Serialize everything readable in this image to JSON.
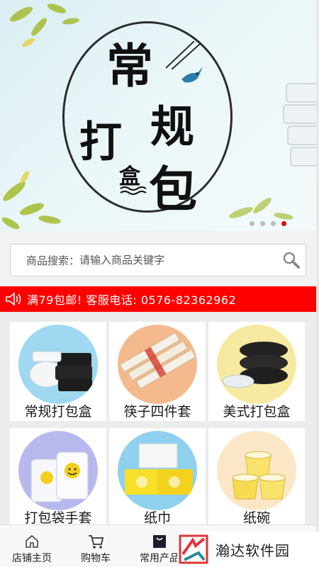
{
  "banner": {
    "title_chars": [
      "常",
      "规",
      "打",
      "包",
      "盒"
    ],
    "slides": 4,
    "active_slide": 4
  },
  "search": {
    "label": "商品搜索：",
    "placeholder": "请输入商品关键字"
  },
  "notice": {
    "text": "满79包邮! 客服电话: 0576-82362962"
  },
  "categories": [
    {
      "label": "常规打包盒"
    },
    {
      "label": "筷子四件套"
    },
    {
      "label": "美式打包盒"
    },
    {
      "label": "打包袋手套"
    },
    {
      "label": "纸巾"
    },
    {
      "label": "纸碗"
    }
  ],
  "bottom_nav": {
    "items": [
      {
        "label": "店铺主页",
        "icon": "home-icon"
      },
      {
        "label": "购物车",
        "icon": "cart-icon"
      },
      {
        "label": "常用产品",
        "icon": "bag-icon"
      }
    ]
  },
  "watermark": {
    "text": "瀚达软件园"
  },
  "colors": {
    "notice_bg": "#ff0000",
    "active_dot": "#e60012"
  }
}
